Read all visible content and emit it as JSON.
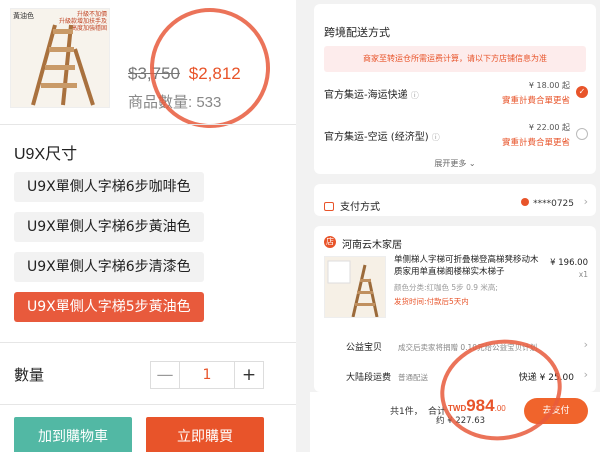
{
  "left": {
    "thumb": {
      "tag": "黃油色",
      "note": "升級不加價\n升級款增加扶手及\n高度加強穩固"
    },
    "old_price": "$3,750",
    "new_price": "$2,812",
    "qty_info": "商品數量: 533",
    "variant_title": "U9X尺寸",
    "variants": [
      {
        "label": "U9X單側人字梯6步咖啡色",
        "active": false
      },
      {
        "label": "U9X單側人字梯6步黃油色",
        "active": false
      },
      {
        "label": "U9X單側人字梯6步清漆色",
        "active": false
      },
      {
        "label": "U9X單側人字梯5步黃油色",
        "active": true
      }
    ],
    "qty_label": "數量",
    "qty_value": "1",
    "minus": "—",
    "plus": "+",
    "cart_label": "加到購物車",
    "buy_label": "立即購買"
  },
  "right": {
    "shipping": {
      "title": "跨境配送方式",
      "notice": "商家至转运仓所需运费计算，请以下方店铺信息为准",
      "options": [
        {
          "label": "官方集运-海运快递",
          "price": "¥ 18.00 起",
          "sub": "實重計費合單更省",
          "selected": true
        },
        {
          "label": "官方集运-空运 (经济型)",
          "price": "¥ 22.00 起",
          "sub": "實重計費合單更省",
          "selected": false
        }
      ],
      "expand": "展开更多"
    },
    "payment": {
      "label": "支付方式",
      "card": "****0725"
    },
    "store": {
      "name": "河南云木家居",
      "item_title": "单侧梯人字梯可折叠梯登高梯凳移动木质家用单直梯阁楼梯实木梯子",
      "item_price": "¥ 196.00",
      "item_qty": "x1",
      "item_variant": "颜色分类:红咖色 5步 0.9 米高;",
      "item_ship": "发货时间:付款后5天内",
      "rows": [
        {
          "label": "公益宝贝",
          "value": "成交后卖家将捐赠 0.10元给公益宝贝计划",
          "right": ""
        },
        {
          "label": "大陆段运费",
          "value": "普通配送",
          "right": "快递 ¥ 25.00"
        }
      ]
    },
    "bottom": {
      "count": "共1件，",
      "total_label": "合计",
      "currency": "TWD",
      "amount": "984",
      "decimals": ".00",
      "approx": "约 ¥ 227.63",
      "submit": "去支付"
    }
  },
  "colors": {
    "accent": "#e8542a",
    "teal": "#52b8a4"
  }
}
